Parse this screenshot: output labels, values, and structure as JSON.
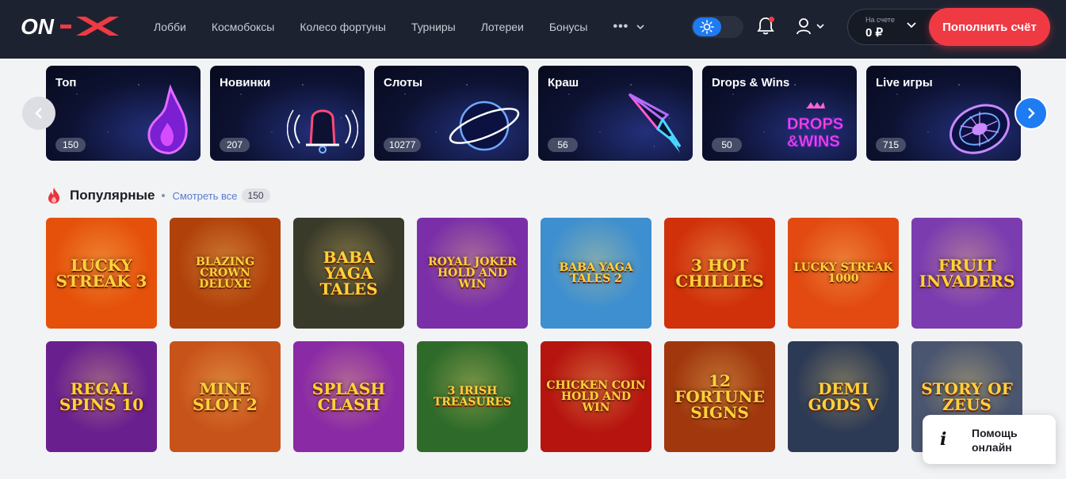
{
  "header": {
    "logo_text": "ON-X",
    "nav": [
      "Лобби",
      "Космобоксы",
      "Колесо фортуны",
      "Турниры",
      "Лотереи",
      "Бонусы"
    ],
    "more_label": "•••",
    "balance_label": "На счете",
    "balance_value": "0 ₽",
    "deposit_label": "Пополнить счёт",
    "accent_color": "#ef3a44"
  },
  "categories": [
    {
      "title": "Топ",
      "count": "150",
      "icon": "flame-icon"
    },
    {
      "title": "Новинки",
      "count": "207",
      "icon": "bell-icon"
    },
    {
      "title": "Слоты",
      "count": "10277",
      "icon": "planet-icon"
    },
    {
      "title": "Краш",
      "count": "56",
      "icon": "rocket-icon"
    },
    {
      "title": "Drops & Wins",
      "count": "50",
      "icon": "drops-wins-logo",
      "art_text": [
        "DROPS",
        "&WINS"
      ]
    },
    {
      "title": "Live игры",
      "count": "715",
      "icon": "roulette-icon"
    }
  ],
  "section": {
    "title": "Популярные",
    "link": "Смотреть все",
    "count": "150"
  },
  "games": [
    {
      "name": "Lucky Streak 3",
      "bg": "#e5510a"
    },
    {
      "name": "Blazing Crown deluxe",
      "bg": "#b0410a"
    },
    {
      "name": "Baba Yaga Tales",
      "bg": "#3a3a2a"
    },
    {
      "name": "Royal Joker Hold and Win",
      "bg": "#7a2fa8"
    },
    {
      "name": "Baba Yaga Tales 2",
      "bg": "#3d8fd0"
    },
    {
      "name": "3 Hot Chillies",
      "bg": "#d0300a"
    },
    {
      "name": "Lucky Streak 1000",
      "bg": "#e24a12"
    },
    {
      "name": "Fruit Invaders",
      "bg": "#7b3cb0"
    },
    {
      "name": "Regal Spins 10",
      "bg": "#6a1f8f"
    },
    {
      "name": "Mine Slot 2",
      "bg": "#c8531a"
    },
    {
      "name": "Splash Clash",
      "bg": "#8a2aa5"
    },
    {
      "name": "3 Irish Treasures",
      "bg": "#2e6b2a"
    },
    {
      "name": "Chicken Coin Hold and Win",
      "bg": "#b6150f"
    },
    {
      "name": "12 Fortune Signs",
      "bg": "#a0370d"
    },
    {
      "name": "Demi Gods V",
      "bg": "#2d3a55"
    },
    {
      "name": "Story of Zeus",
      "bg": "#4a5570"
    }
  ],
  "help": {
    "label": "Помощь онлайн"
  }
}
